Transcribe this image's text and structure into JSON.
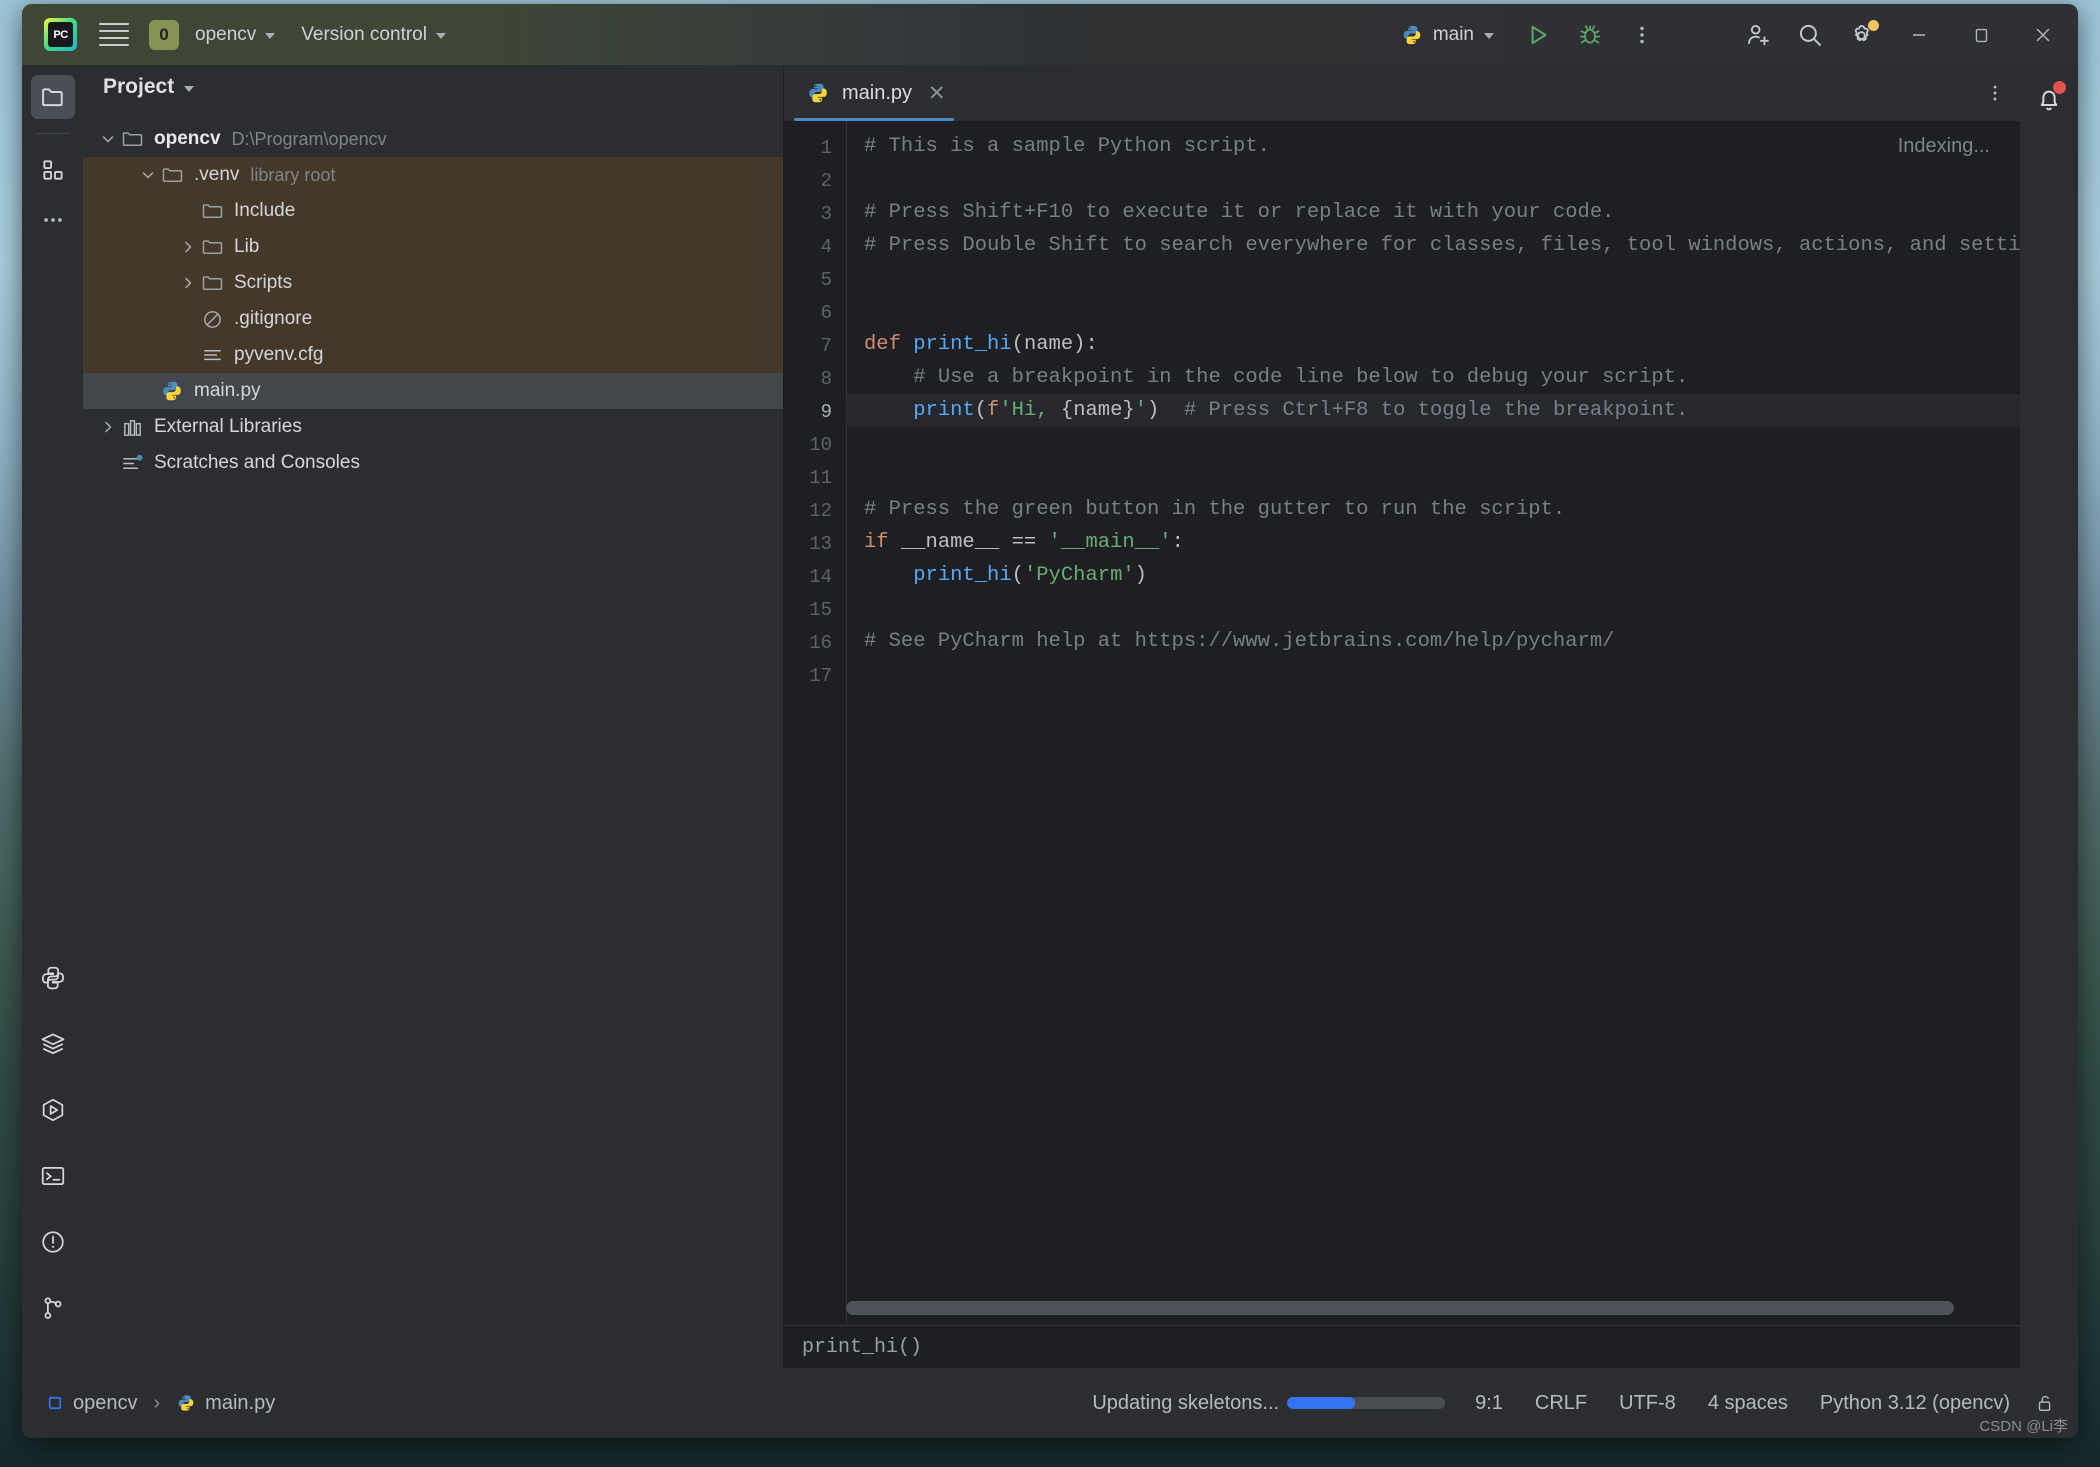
{
  "titlebar": {
    "app_icon": "pycharm-logo-icon",
    "app_icon_text": "PC",
    "menu_icon": "hamburger-menu-icon",
    "project_badge": "0",
    "project_name": "opencv",
    "version_control": "Version control",
    "run_config_name": "main",
    "run_icon": "run-icon",
    "debug_icon": "debug-icon",
    "more_icon": "more-vertical-icon",
    "account_icon": "add-user-icon",
    "search_icon": "search-icon",
    "settings_icon": "gear-icon",
    "minimize_icon": "minimize-icon",
    "maximize_icon": "maximize-icon",
    "close_icon": "close-icon"
  },
  "rail": {
    "top": [
      {
        "name": "project-tool-window",
        "icon": "folder-icon",
        "active": true
      },
      {
        "name": "structure-tool-window",
        "icon": "grid-blocks-icon",
        "active": false
      },
      {
        "name": "more-tool-windows",
        "icon": "ellipsis-icon",
        "active": false
      }
    ],
    "bottom": [
      {
        "name": "python-console",
        "icon": "python-icon"
      },
      {
        "name": "database-tool-window",
        "icon": "layers-icon"
      },
      {
        "name": "run-tool-window",
        "icon": "run-hex-icon"
      },
      {
        "name": "terminal-tool-window",
        "icon": "terminal-icon"
      },
      {
        "name": "problems-tool-window",
        "icon": "warning-circle-icon"
      },
      {
        "name": "version-control-tool-window",
        "icon": "branch-icon"
      }
    ]
  },
  "project_panel": {
    "title": "Project",
    "chevron_icon": "chevron-down-icon",
    "tree": [
      {
        "label": "opencv",
        "sub": "D:\\Program\\opencv",
        "icon": "folder-icon",
        "arrow": "expanded",
        "indent": 0,
        "bold": true,
        "highlight": "none"
      },
      {
        "label": ".venv",
        "sub": "library root",
        "icon": "folder-icon",
        "arrow": "expanded",
        "indent": 1,
        "bold": false,
        "highlight": "venv"
      },
      {
        "label": "Include",
        "sub": "",
        "icon": "folder-icon",
        "arrow": "none",
        "indent": 2,
        "bold": false,
        "highlight": "venv"
      },
      {
        "label": "Lib",
        "sub": "",
        "icon": "folder-icon",
        "arrow": "collapsed",
        "indent": 2,
        "bold": false,
        "highlight": "venv"
      },
      {
        "label": "Scripts",
        "sub": "",
        "icon": "folder-icon",
        "arrow": "collapsed",
        "indent": 2,
        "bold": false,
        "highlight": "venv"
      },
      {
        "label": ".gitignore",
        "sub": "",
        "icon": "gitignore-icon",
        "arrow": "none",
        "indent": 2,
        "bold": false,
        "highlight": "venv"
      },
      {
        "label": "pyvenv.cfg",
        "sub": "",
        "icon": "config-file-icon",
        "arrow": "none",
        "indent": 2,
        "bold": false,
        "highlight": "venv"
      },
      {
        "label": "main.py",
        "sub": "",
        "icon": "python-file-icon",
        "arrow": "none",
        "indent": 1,
        "bold": false,
        "highlight": "selected"
      },
      {
        "label": "External Libraries",
        "sub": "",
        "icon": "libraries-icon",
        "arrow": "collapsed",
        "indent": 0,
        "bold": false,
        "highlight": "none"
      },
      {
        "label": "Scratches and Consoles",
        "sub": "",
        "icon": "scratches-icon",
        "arrow": "none",
        "indent": 0,
        "bold": false,
        "highlight": "none"
      }
    ]
  },
  "editor": {
    "tab": {
      "label": "main.py",
      "icon": "python-file-icon",
      "close_icon": "close-icon"
    },
    "options_icon": "more-vertical-icon",
    "indexing_status": "Indexing...",
    "breadcrumb": "print_hi()",
    "current_line": 9,
    "total_lines": 17,
    "line_numbers": [
      "1",
      "2",
      "3",
      "4",
      "5",
      "6",
      "7",
      "8",
      "9",
      "10",
      "11",
      "12",
      "13",
      "14",
      "15",
      "16",
      "17"
    ],
    "code": [
      {
        "n": 1,
        "text": "# This is a sample Python script."
      },
      {
        "n": 2,
        "text": ""
      },
      {
        "n": 3,
        "text": "# Press Shift+F10 to execute it or replace it with your code."
      },
      {
        "n": 4,
        "text": "# Press Double Shift to search everywhere for classes, files, tool windows, actions, and settings."
      },
      {
        "n": 5,
        "text": ""
      },
      {
        "n": 6,
        "text": ""
      },
      {
        "n": 7,
        "text": "def print_hi(name):"
      },
      {
        "n": 8,
        "text": "    # Use a breakpoint in the code line below to debug your script."
      },
      {
        "n": 9,
        "text": "    print(f'Hi, {name}')  # Press Ctrl+F8 to toggle the breakpoint."
      },
      {
        "n": 10,
        "text": ""
      },
      {
        "n": 11,
        "text": ""
      },
      {
        "n": 12,
        "text": "# Press the green button in the gutter to run the script."
      },
      {
        "n": 13,
        "text": "if __name__ == '__main__':"
      },
      {
        "n": 14,
        "text": "    print_hi('PyCharm')"
      },
      {
        "n": 15,
        "text": ""
      },
      {
        "n": 16,
        "text": "# See PyCharm help at https://www.jetbrains.com/help/pycharm/"
      },
      {
        "n": 17,
        "text": ""
      }
    ]
  },
  "notifications": {
    "icon": "bell-icon",
    "has_badge": true,
    "badge_color": "#e05252"
  },
  "statusbar": {
    "breadcrumb_project": "opencv",
    "breadcrumb_separator": "›",
    "breadcrumb_file": "main.py",
    "progress_label": "Updating skeletons...",
    "progress_percent": 43,
    "progress_color": "#3574f0",
    "cursor_position": "9:1",
    "line_separator": "CRLF",
    "encoding": "UTF-8",
    "indent": "4 spaces",
    "interpreter": "Python 3.12 (opencv)",
    "lock_icon": "unlocked-icon"
  },
  "watermark": "CSDN @Li李",
  "colors": {
    "window_bg": "#2b2d30",
    "editor_bg": "#1e1f22",
    "venv_highlight": "#443829",
    "selection": "#43464b",
    "accent_blue": "#3574f0",
    "tab_underline": "#4a88c7",
    "title_green": "#3e4736"
  }
}
